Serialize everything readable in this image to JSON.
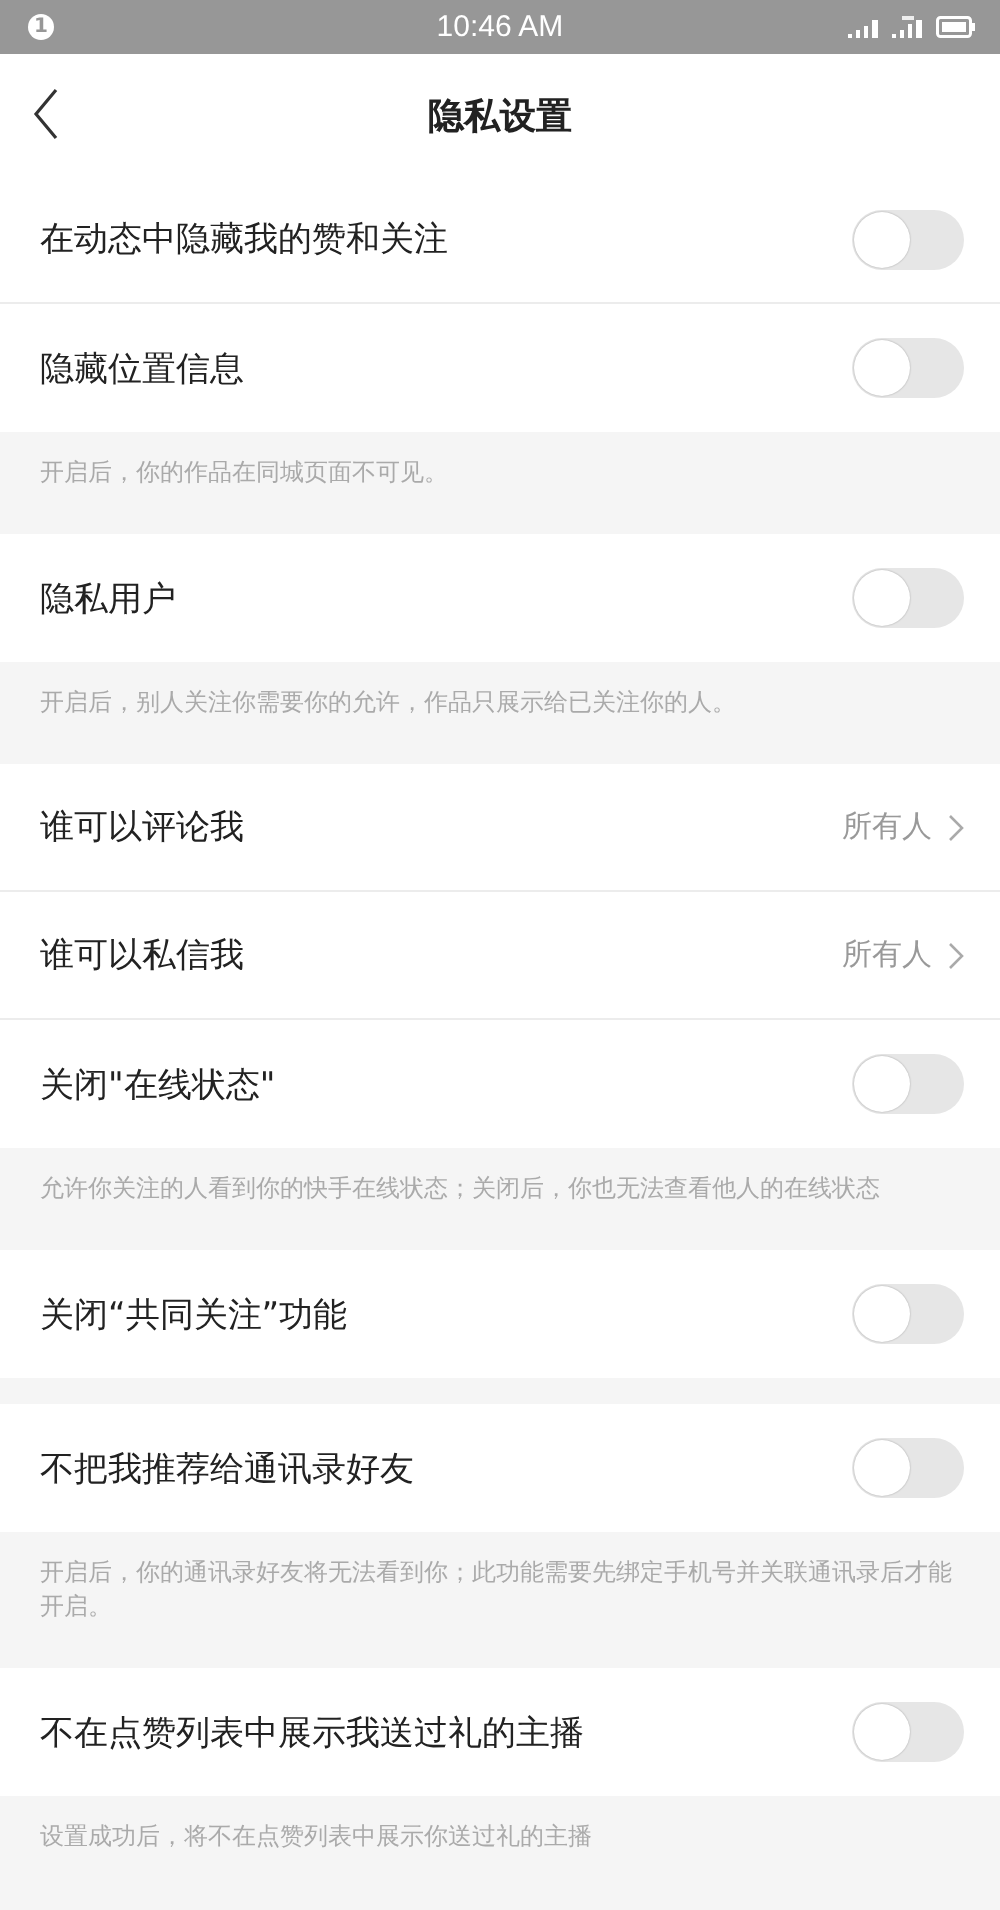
{
  "status_bar": {
    "notification_count": "1",
    "time": "10:46 AM"
  },
  "header": {
    "title": "隐私设置"
  },
  "sections": [
    {
      "rows": [
        {
          "kind": "toggle",
          "label": "在动态中隐藏我的赞和关注",
          "on": false
        },
        {
          "kind": "toggle",
          "label": "隐藏位置信息",
          "on": false
        }
      ],
      "note": "开启后，你的作品在同城页面不可见。"
    },
    {
      "rows": [
        {
          "kind": "toggle",
          "label": "隐私用户",
          "on": false
        }
      ],
      "note": "开启后，别人关注你需要你的允许，作品只展示给已关注你的人。"
    },
    {
      "rows": [
        {
          "kind": "choice",
          "label": "谁可以评论我",
          "value": "所有人"
        },
        {
          "kind": "choice",
          "label": "谁可以私信我",
          "value": "所有人"
        },
        {
          "kind": "toggle",
          "label": "关闭\"在线状态\"",
          "on": false
        }
      ],
      "note": "允许你关注的人看到你的快手在线状态；关闭后，你也无法查看他人的在线状态"
    },
    {
      "rows": [
        {
          "kind": "toggle",
          "label": "关闭“共同关注”功能",
          "on": false
        }
      ]
    },
    {
      "rows": [
        {
          "kind": "toggle",
          "label": "不把我推荐给通讯录好友",
          "on": false
        }
      ],
      "note": "开启后，你的通讯录好友将无法看到你；此功能需要先绑定手机号并关联通讯录后才能开启。"
    },
    {
      "rows": [
        {
          "kind": "toggle",
          "label": "不在点赞列表中展示我送过礼的主播",
          "on": false
        }
      ],
      "note": "设置成功后，将不在点赞列表中展示你送过礼的主播"
    }
  ]
}
